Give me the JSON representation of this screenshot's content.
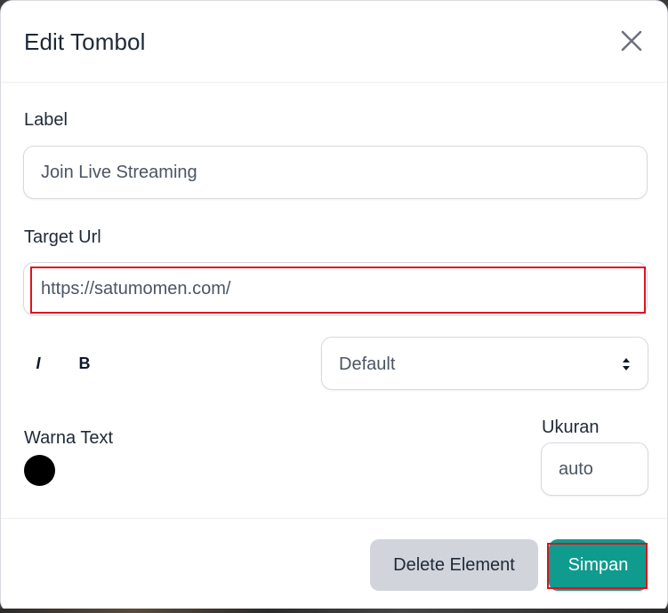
{
  "dialog": {
    "title": "Edit Tombol",
    "close_icon": "close-icon"
  },
  "form": {
    "label_field": {
      "label": "Label",
      "value": "Join Live Streaming"
    },
    "target_url_field": {
      "label": "Target Url",
      "value": "https://satumomen.com/"
    },
    "format": {
      "italic_label": "I",
      "bold_label": "B"
    },
    "size_select": {
      "selected": "Default"
    },
    "text_color": {
      "label": "Warna Text",
      "color": "#000000"
    },
    "ukuran": {
      "label": "Ukuran",
      "value": "auto"
    }
  },
  "footer": {
    "delete_label": "Delete Element",
    "save_label": "Simpan"
  },
  "colors": {
    "accent": "#0f9b8e",
    "highlight": "#e0111d",
    "secondary_button": "#d1d5db"
  }
}
